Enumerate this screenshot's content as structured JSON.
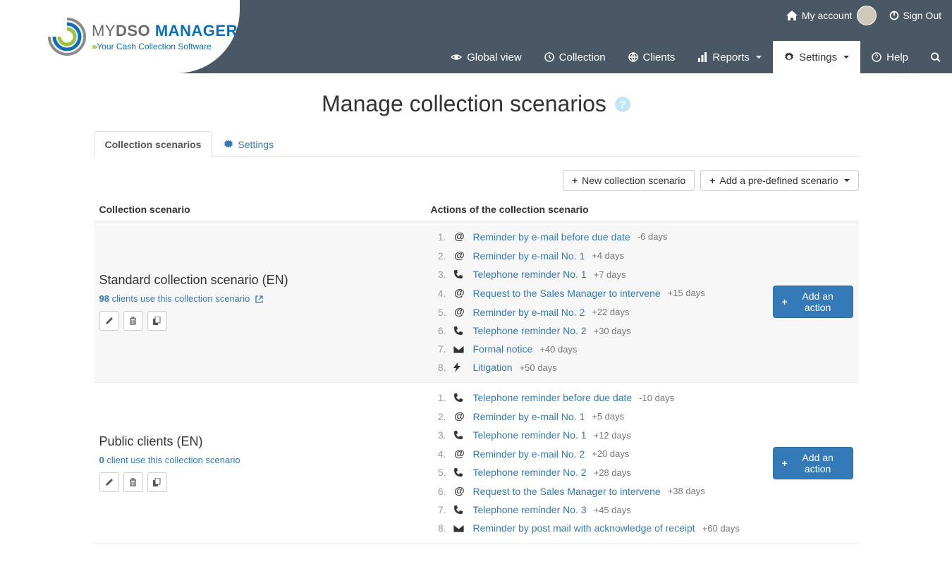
{
  "brand": {
    "my": "MY",
    "dso": "DSO",
    "manager": "MANAGER",
    "tagline": "Your Cash Collection Software"
  },
  "topbar": {
    "my_account": "My account",
    "sign_out": "Sign Out"
  },
  "nav": {
    "global_view": "Global view",
    "collection": "Collection",
    "clients": "Clients",
    "reports": "Reports",
    "settings": "Settings",
    "help": "Help"
  },
  "page": {
    "title": "Manage collection scenarios"
  },
  "tabs": {
    "scenarios": "Collection scenarios",
    "settings": "Settings"
  },
  "toolbar": {
    "new_scenario": "New collection scenario",
    "add_predefined": "Add a pre-defined scenario"
  },
  "columns": {
    "scenario": "Collection scenario",
    "actions": "Actions of the collection scenario"
  },
  "add_action_label": "Add an action",
  "scenarios": [
    {
      "name": "Standard collection scenario (EN)",
      "clients_count": "98",
      "clients_text": "clients use this collection scenario",
      "actions": [
        {
          "n": "1.",
          "icon": "at",
          "label": "Reminder by e-mail before due date",
          "days": "-6 days"
        },
        {
          "n": "2.",
          "icon": "at",
          "label": "Reminder by e-mail No. 1",
          "days": "+4 days"
        },
        {
          "n": "3.",
          "icon": "phone",
          "label": "Telephone reminder No. 1",
          "days": "+7 days"
        },
        {
          "n": "4.",
          "icon": "at",
          "label": "Request to the Sales Manager to intervene",
          "days": "+15 days"
        },
        {
          "n": "5.",
          "icon": "at",
          "label": "Reminder by e-mail No. 2",
          "days": "+22 days"
        },
        {
          "n": "6.",
          "icon": "phone",
          "label": "Telephone reminder No. 2",
          "days": "+30 days"
        },
        {
          "n": "7.",
          "icon": "envelope",
          "label": "Formal notice",
          "days": "+40 days"
        },
        {
          "n": "8.",
          "icon": "bolt",
          "label": "Litigation",
          "days": "+50 days"
        }
      ]
    },
    {
      "name": "Public clients (EN)",
      "clients_count": "0",
      "clients_text": "client use this collection scenario",
      "actions": [
        {
          "n": "1.",
          "icon": "phone",
          "label": "Telephone reminder before due date",
          "days": "-10 days"
        },
        {
          "n": "2.",
          "icon": "at",
          "label": "Reminder by e-mail No. 1",
          "days": "+5 days"
        },
        {
          "n": "3.",
          "icon": "phone",
          "label": "Telephone reminder No. 1",
          "days": "+12 days"
        },
        {
          "n": "4.",
          "icon": "at",
          "label": "Reminder by e-mail No. 2",
          "days": "+20 days"
        },
        {
          "n": "5.",
          "icon": "phone",
          "label": "Telephone reminder No. 2",
          "days": "+28 days"
        },
        {
          "n": "6.",
          "icon": "at",
          "label": "Request to the Sales Manager to intervene",
          "days": "+38 days"
        },
        {
          "n": "7.",
          "icon": "phone",
          "label": "Telephone reminder No. 3",
          "days": "+45 days"
        },
        {
          "n": "8.",
          "icon": "envelope",
          "label": "Reminder by post mail with acknowledge of receipt",
          "days": "+60 days"
        }
      ]
    }
  ]
}
